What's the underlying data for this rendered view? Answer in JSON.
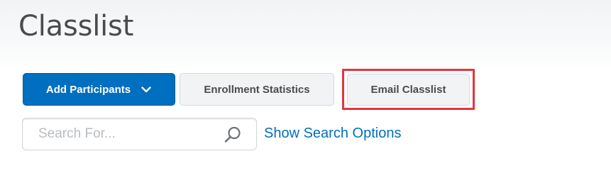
{
  "page": {
    "title": "Classlist"
  },
  "toolbar": {
    "add_participants_label": "Add Participants",
    "enrollment_statistics_label": "Enrollment Statistics",
    "email_classlist_label": "Email Classlist"
  },
  "search": {
    "placeholder": "Search For...",
    "value": "",
    "show_options_label": "Show Search Options"
  },
  "icons": {
    "add_participants_dropdown": "chevron-down-icon",
    "search": "search-icon"
  },
  "colors": {
    "primary": "#006fbf",
    "highlight": "#e2363c",
    "title_text": "#494c4e",
    "link": "#006fbf"
  }
}
